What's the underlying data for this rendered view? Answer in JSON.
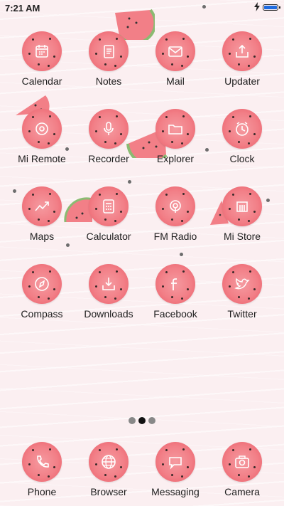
{
  "status_bar": {
    "time": "7:21 AM",
    "charging": true,
    "battery_color": "#1e6be0"
  },
  "apps": [
    {
      "label": "Calendar",
      "icon": "calendar-icon"
    },
    {
      "label": "Notes",
      "icon": "notes-icon"
    },
    {
      "label": "Mail",
      "icon": "mail-icon"
    },
    {
      "label": "Updater",
      "icon": "updater-icon"
    },
    {
      "label": "Mi Remote",
      "icon": "remote-icon"
    },
    {
      "label": "Recorder",
      "icon": "microphone-icon"
    },
    {
      "label": "Explorer",
      "icon": "folder-icon"
    },
    {
      "label": "Clock",
      "icon": "clock-icon"
    },
    {
      "label": "Maps",
      "icon": "map-icon"
    },
    {
      "label": "Calculator",
      "icon": "calculator-icon"
    },
    {
      "label": "FM Radio",
      "icon": "radio-icon"
    },
    {
      "label": "Mi Store",
      "icon": "store-icon"
    },
    {
      "label": "Compass",
      "icon": "compass-icon"
    },
    {
      "label": "Downloads",
      "icon": "download-icon"
    },
    {
      "label": "Facebook",
      "icon": "facebook-icon"
    },
    {
      "label": "Twitter",
      "icon": "twitter-icon"
    }
  ],
  "page_indicator": {
    "pages": 3,
    "current": 2
  },
  "dock": [
    {
      "label": "Phone",
      "icon": "phone-icon"
    },
    {
      "label": "Browser",
      "icon": "globe-icon"
    },
    {
      "label": "Messaging",
      "icon": "message-icon"
    },
    {
      "label": "Camera",
      "icon": "camera-icon"
    }
  ],
  "theme": {
    "watermelon_flesh": "#f27f87",
    "rind": "#6ea456",
    "background": "#fbeff1"
  }
}
